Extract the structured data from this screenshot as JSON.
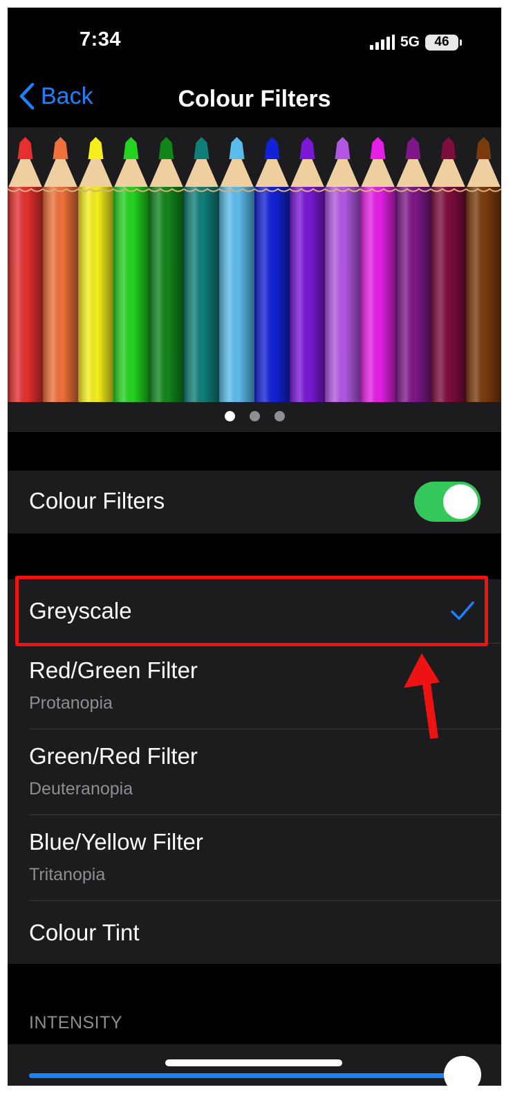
{
  "status_bar": {
    "time": "7:34",
    "network": "5G",
    "battery": "46"
  },
  "nav": {
    "back_label": "Back",
    "title": "Colour Filters"
  },
  "pencil_colors": [
    "#e5302f",
    "#f0703a",
    "#f6ef1c",
    "#23d31f",
    "#11841a",
    "#0f7e79",
    "#5bbcec",
    "#1222d8",
    "#7a18d6",
    "#b257e3",
    "#e61fe6",
    "#7e1689",
    "#7c0d3c",
    "#7a3a0c"
  ],
  "page_control": {
    "count": 3,
    "active": 0
  },
  "colour_filters_toggle": {
    "label": "Colour Filters",
    "on": true
  },
  "filters": [
    {
      "label": "Greyscale",
      "sub": "",
      "selected": true
    },
    {
      "label": "Red/Green Filter",
      "sub": "Protanopia",
      "selected": false
    },
    {
      "label": "Green/Red Filter",
      "sub": "Deuteranopia",
      "selected": false
    },
    {
      "label": "Blue/Yellow Filter",
      "sub": "Tritanopia",
      "selected": false
    },
    {
      "label": "Colour Tint",
      "sub": "",
      "selected": false
    }
  ],
  "intensity": {
    "header": "INTENSITY",
    "value": 1.0
  },
  "colors": {
    "accent": "#1a82ff",
    "toggle_on": "#34c759",
    "highlight": "#ee1313"
  }
}
